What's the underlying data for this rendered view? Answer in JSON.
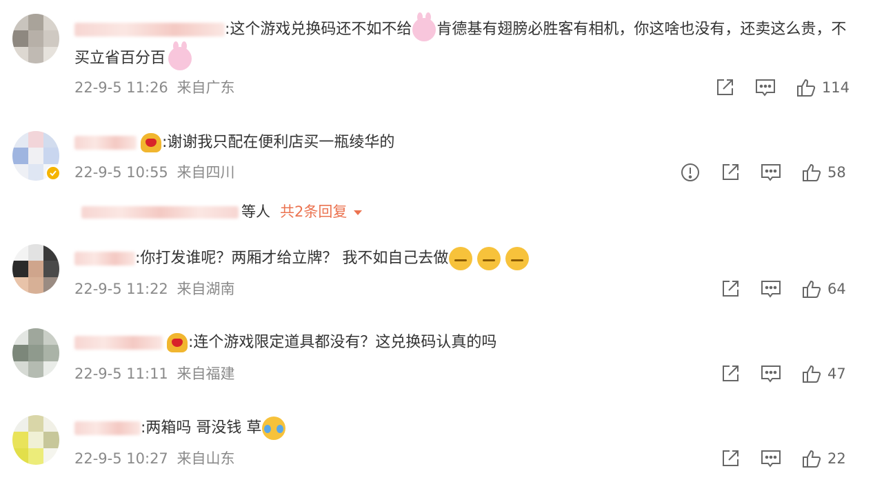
{
  "comments": [
    {
      "text_part1": ":这个游戏兑换码还不如不给",
      "text_part2": "肯德基有翅膀必胜客有相机，你这啥也没有，还卖这么贵，不买立省百分百",
      "emojis": [
        "rabbit-emoji",
        "rabbit-emoji"
      ],
      "time": "22-9-5 11:26",
      "location": "来自广东",
      "likes": "114",
      "has_report": false
    },
    {
      "text_part1": ":谢谢我只配在便利店买一瓶绫华的",
      "emojis": [
        "heart-emoji"
      ],
      "time": "22-9-5 10:55",
      "location": "来自四川",
      "likes": "58",
      "has_report": true,
      "verified": true
    },
    {
      "text_part1": ":你打发谁呢？两厢才给立牌？ 我不如自己去做",
      "emojis": [
        "smirk-emoji",
        "smirk-emoji",
        "smirk-emoji"
      ],
      "time": "22-9-5 11:22",
      "location": "来自湖南",
      "likes": "64",
      "has_report": false
    },
    {
      "text_part1": ":连个游戏限定道具都没有？这兑换码认真的吗",
      "emojis": [
        "heart-emoji"
      ],
      "time": "22-9-5 11:11",
      "location": "来自福建",
      "likes": "47",
      "has_report": false
    },
    {
      "text_part1": ":两箱吗 哥没钱 草",
      "emojis": [
        "laugh-cry-emoji"
      ],
      "time": "22-9-5 10:27",
      "location": "来自山东",
      "likes": "22",
      "has_report": false
    }
  ],
  "replies": {
    "suffix": "等人",
    "toggle_label": "共2条回复"
  },
  "icons": {
    "share": "share-icon",
    "comment": "comment-icon",
    "like": "thumbs-up-icon",
    "report": "report-icon"
  },
  "colors": {
    "link_orange": "#eb7350",
    "meta_gray": "#8a8a8a",
    "verified_gold": "#f5b400"
  }
}
